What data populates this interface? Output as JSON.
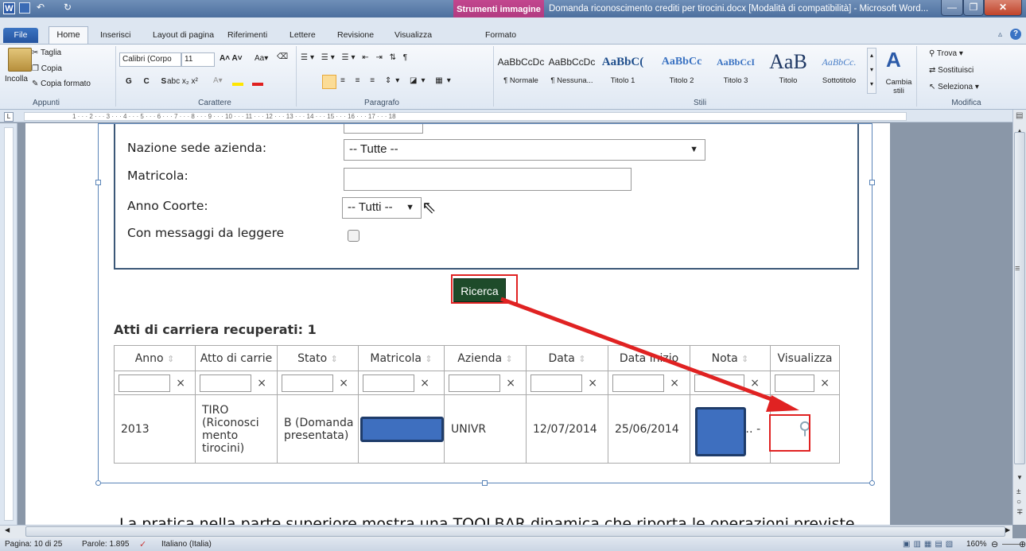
{
  "window": {
    "context_tab": "Strumenti immagine",
    "title": "Domanda riconoscimento crediti per tirocini.docx [Modalità di compatibilità] - Microsoft Word..."
  },
  "ribbon_tabs": [
    "File",
    "Home",
    "Inserisci",
    "Layout di pagina",
    "Riferimenti",
    "Lettere",
    "Revisione",
    "Visualizza",
    "Formato"
  ],
  "clipboard": {
    "paste": "Incolla",
    "cut": "Taglia",
    "copy": "Copia",
    "format_painter": "Copia formato",
    "group": "Appunti"
  },
  "font": {
    "name": "Calibri (Corpo",
    "size": "11",
    "group": "Carattere"
  },
  "paragraph": {
    "group": "Paragrafo"
  },
  "styles": {
    "group": "Stili",
    "items": [
      {
        "preview": "AaBbCcDc",
        "name": "¶ Normale"
      },
      {
        "preview": "AaBbCcDc",
        "name": "¶ Nessuna..."
      },
      {
        "preview": "AaBbC(",
        "name": "Titolo 1"
      },
      {
        "preview": "AaBbCc",
        "name": "Titolo 2"
      },
      {
        "preview": "AaBbCcI",
        "name": "Titolo 3"
      },
      {
        "preview": "AaB",
        "name": "Titolo"
      },
      {
        "preview": "AaBbCc.",
        "name": "Sottotitolo"
      }
    ],
    "change": "Cambia stili"
  },
  "editing": {
    "find": "Trova",
    "replace": "Sostituisci",
    "select": "Seleziona",
    "group": "Modifica"
  },
  "ruler_marks": "1 · · · 2 · · · 3 · · · 4 · · · 5 · · · 6 · · · 7 · · · 8 · · · 9 · · · 10 · · · 11 · · · 12 · · · 13 · · · 14 · · · 15 · · · 16 · · · 17 · · · 18",
  "form": {
    "nation_label": "Nazione sede azienda:",
    "nation_value": "-- Tutte --",
    "matricola_label": "Matricola:",
    "matricola_value": "",
    "coorte_label": "Anno Coorte:",
    "coorte_value": "-- Tutti --",
    "messages_label": "Con messaggi da leggere",
    "search_button": "Ricerca"
  },
  "results": {
    "title": "Atti di carriera recuperati: 1",
    "columns": [
      "Anno",
      "Atto di carrie",
      "Stato",
      "Matricola",
      "Azienda",
      "Data",
      "Data inizio",
      "Nota",
      "Visualizza"
    ],
    "clear_glyph": "×",
    "rows": [
      {
        "anno": "2013",
        "atto": "TIRO (Riconosci mento tirocini)",
        "stato": "B (Domanda presentata)",
        "matricola": "",
        "azienda": "UNIVR",
        "data": "12/07/2014",
        "data_inizio": "25/06/2014",
        "nota": "A… NI A… -"
      }
    ]
  },
  "body_text": "La pratica nella parte superiore mostra una TOOLBAR dinamica che riporta le operazioni previste",
  "status": {
    "page": "Pagina: 10 di 25",
    "words": "Parole: 1.895",
    "language": "Italiano (Italia)",
    "zoom": "160%"
  }
}
